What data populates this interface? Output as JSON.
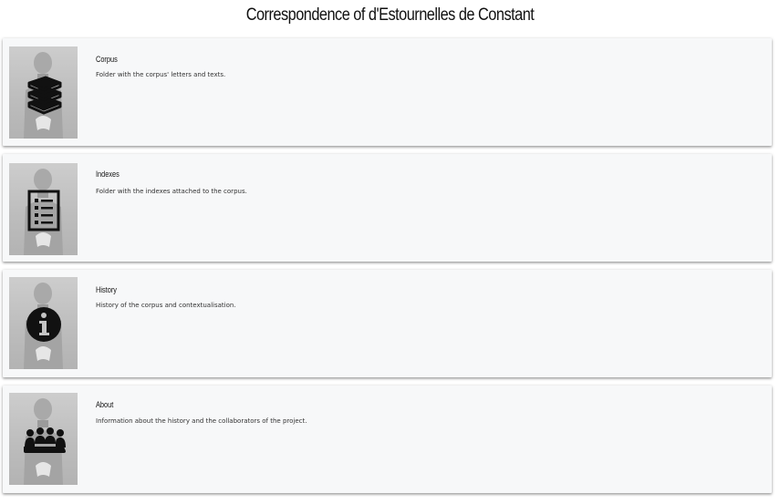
{
  "page": {
    "title": "Correspondence of d'Estournelles de Constant"
  },
  "cards": [
    {
      "title": "Corpus",
      "description": "Folder with the corpus' letters and texts.",
      "icon": "books-icon"
    },
    {
      "title": "Indexes",
      "description": "Folder with the indexes attached to the corpus.",
      "icon": "list-document-icon"
    },
    {
      "title": "History",
      "description": "History of the corpus and contextualisation.",
      "icon": "info-icon"
    },
    {
      "title": "About",
      "description": "Information about the history and the collaborators of the project.",
      "icon": "group-meeting-icon"
    }
  ],
  "colors": {
    "card_background": "#f7f8f9",
    "icon_color": "#111111",
    "text_color": "#111111"
  }
}
